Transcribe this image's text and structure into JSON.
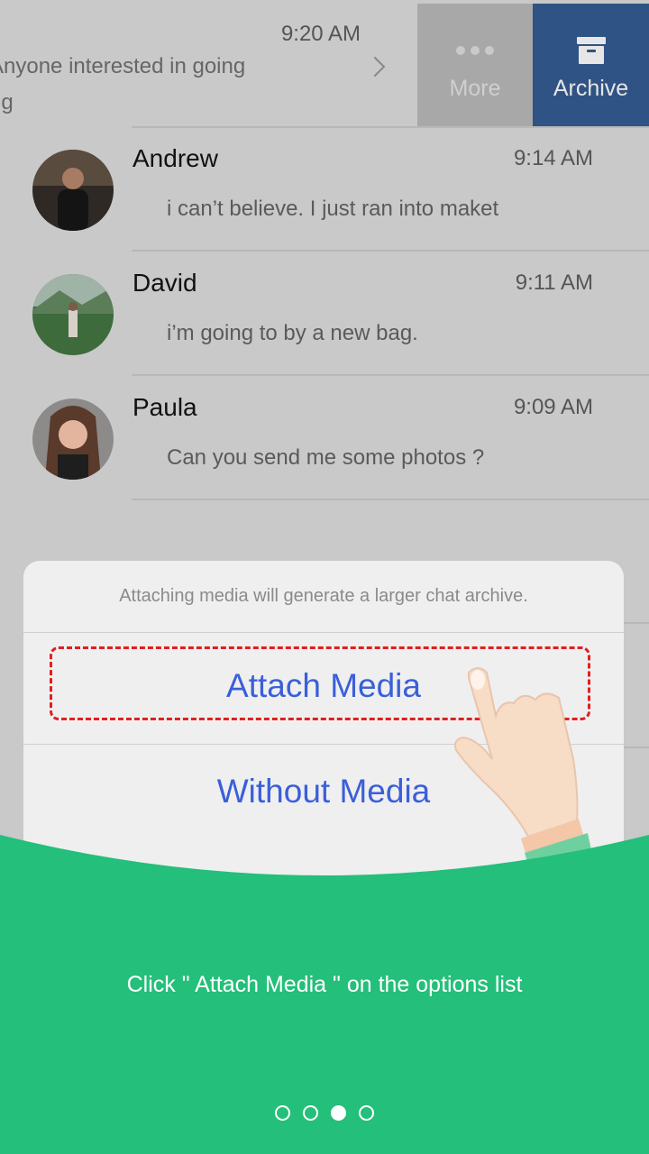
{
  "swiped_conversation": {
    "time": "9:20 AM",
    "line1": "Anyone interested in going",
    "line2": "ng",
    "actions": [
      {
        "label": "More",
        "icon": "more-dots-icon"
      },
      {
        "label": "Archive",
        "icon": "archive-box-icon"
      }
    ]
  },
  "conversations": [
    {
      "name": "Andrew",
      "time": "9:14 AM",
      "message": "i can’t believe. I just ran into maket",
      "avatar_color": "#3b2f2a"
    },
    {
      "name": "David",
      "time": "9:11 AM",
      "message": "i’m going to by a new bag.",
      "avatar_color": "#3f6a3a"
    },
    {
      "name": "Paula",
      "time": "9:09 AM",
      "message": "Can you send me some photos ?",
      "avatar_color": "#c98a74"
    }
  ],
  "action_sheet": {
    "caption": "Attaching media will generate a larger chat archive.",
    "options": [
      {
        "label": "Attach Media",
        "highlighted": true
      },
      {
        "label": "Without Media",
        "highlighted": false
      }
    ]
  },
  "tutorial": {
    "instruction": "Click \" Attach Media \" on the options list",
    "page_count": 4,
    "active_page": 3
  },
  "colors": {
    "overlay_bg": "#c9c9c9",
    "archive_blue": "#2f5385",
    "more_gray": "#a8a8a8",
    "link_blue": "#3a5fd8",
    "highlight_red": "#e01f1f",
    "tutorial_green": "#24bf7a"
  }
}
